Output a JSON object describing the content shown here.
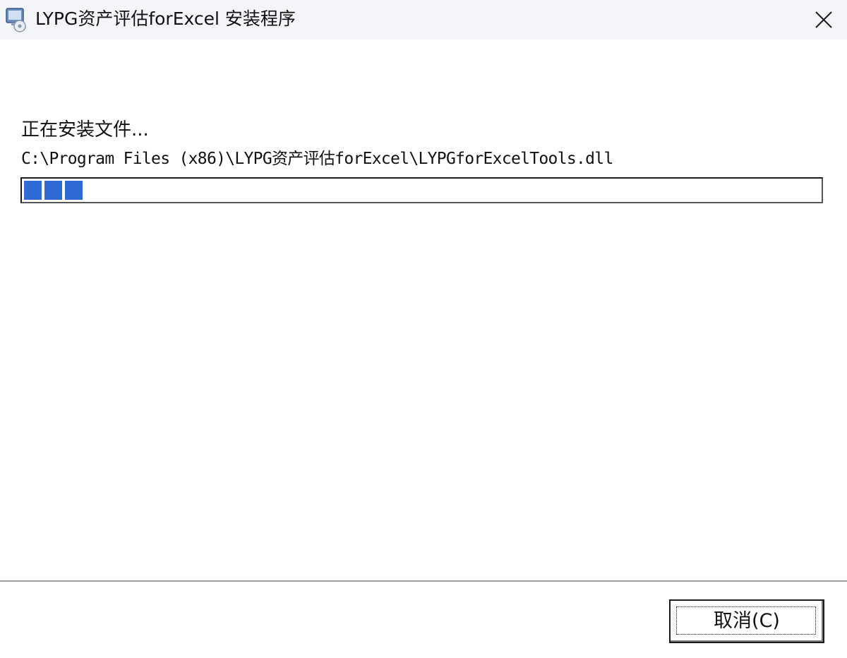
{
  "window": {
    "title": "LYPG资产评估forExcel 安装程序",
    "app_icon": "installer-icon",
    "close_icon": "close-icon"
  },
  "main": {
    "status": "正在安装文件...",
    "file_path": "C:\\Program Files (x86)\\LYPG资产评估forExcel\\LYPGforExcelTools.dll",
    "progress": {
      "fraction": 0.08,
      "filled_blocks": 3,
      "color": "#2f6bd4"
    }
  },
  "footer": {
    "cancel_label": "取消(C)"
  }
}
